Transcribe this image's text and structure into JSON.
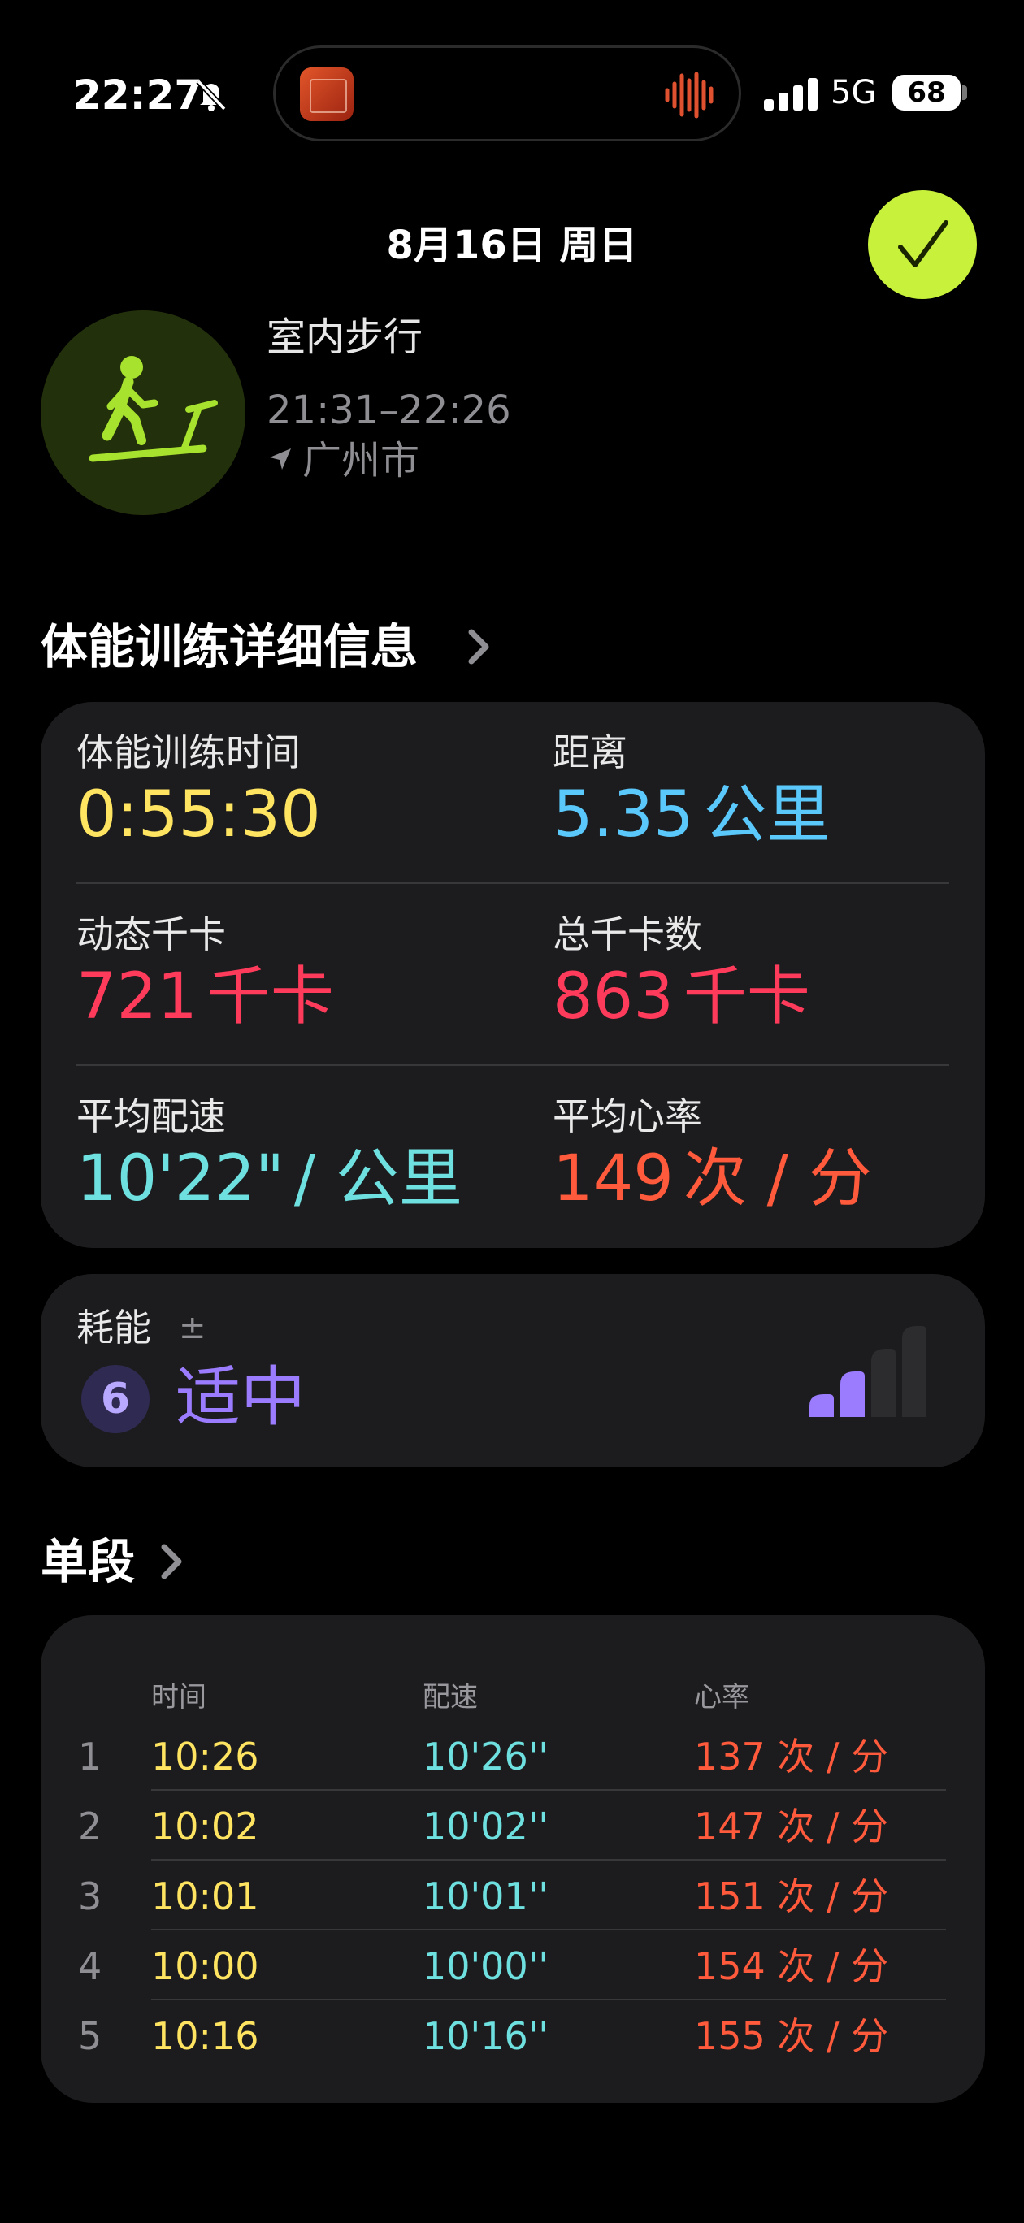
{
  "status_bar": {
    "time": "22:27",
    "network": "5G",
    "battery": "68"
  },
  "header": {
    "date_title": "8月16日 周日"
  },
  "activity": {
    "name": "室内步行",
    "time_range": "21:31–22:26",
    "location": "广州市"
  },
  "details_section": {
    "title": "体能训练详细信息",
    "metrics": [
      {
        "label": "体能训练时间",
        "value": "0:55:30",
        "unit": "",
        "color": "#ffe461"
      },
      {
        "label": "距离",
        "value": "5.35",
        "unit": "公里",
        "color": "#5ac8fa"
      },
      {
        "label": "动态千卡",
        "value": "721",
        "unit": "千卡",
        "color": "#ff3b5c"
      },
      {
        "label": "总千卡数",
        "value": "863",
        "unit": "千卡",
        "color": "#ff3b5c"
      },
      {
        "label": "平均配速",
        "value": "10'22\"",
        "unit": "/ 公里",
        "color": "#6fe0e0"
      },
      {
        "label": "平均心率",
        "value": "149",
        "unit": "次 / 分",
        "color": "#ff5a3c"
      }
    ]
  },
  "effort": {
    "label": "耗能",
    "adjust_symbol": "±",
    "score": "6",
    "level_text": "适中",
    "level_filled_bars": 2,
    "level_total_bars": 4,
    "color": "#9b7cff"
  },
  "splits_section": {
    "title": "单段",
    "columns": [
      "时间",
      "配速",
      "心率"
    ],
    "rows": [
      {
        "index": "1",
        "time": "10:26",
        "pace": "10'26''",
        "hr": "137 次 / 分"
      },
      {
        "index": "2",
        "time": "10:02",
        "pace": "10'02''",
        "hr": "147 次 / 分"
      },
      {
        "index": "3",
        "time": "10:01",
        "pace": "10'01''",
        "hr": "151 次 / 分"
      },
      {
        "index": "4",
        "time": "10:00",
        "pace": "10'00''",
        "hr": "154 次 / 分"
      },
      {
        "index": "5",
        "time": "10:16",
        "pace": "10'16''",
        "hr": "155 次 / 分"
      }
    ]
  },
  "icons": {
    "silent": "bell-slash-icon",
    "island_app": "app-thumbnail-icon",
    "island_audio": "audio-waveform-icon",
    "signal": "cellular-signal-icon",
    "done": "checkmark-icon",
    "activity": "treadmill-walker-icon",
    "location": "location-arrow-icon",
    "chevron": "chevron-right-icon",
    "effort_level": "effort-bars-icon"
  },
  "colors": {
    "accent_done": "#c7f13b",
    "card_bg": "#1c1c1e"
  }
}
